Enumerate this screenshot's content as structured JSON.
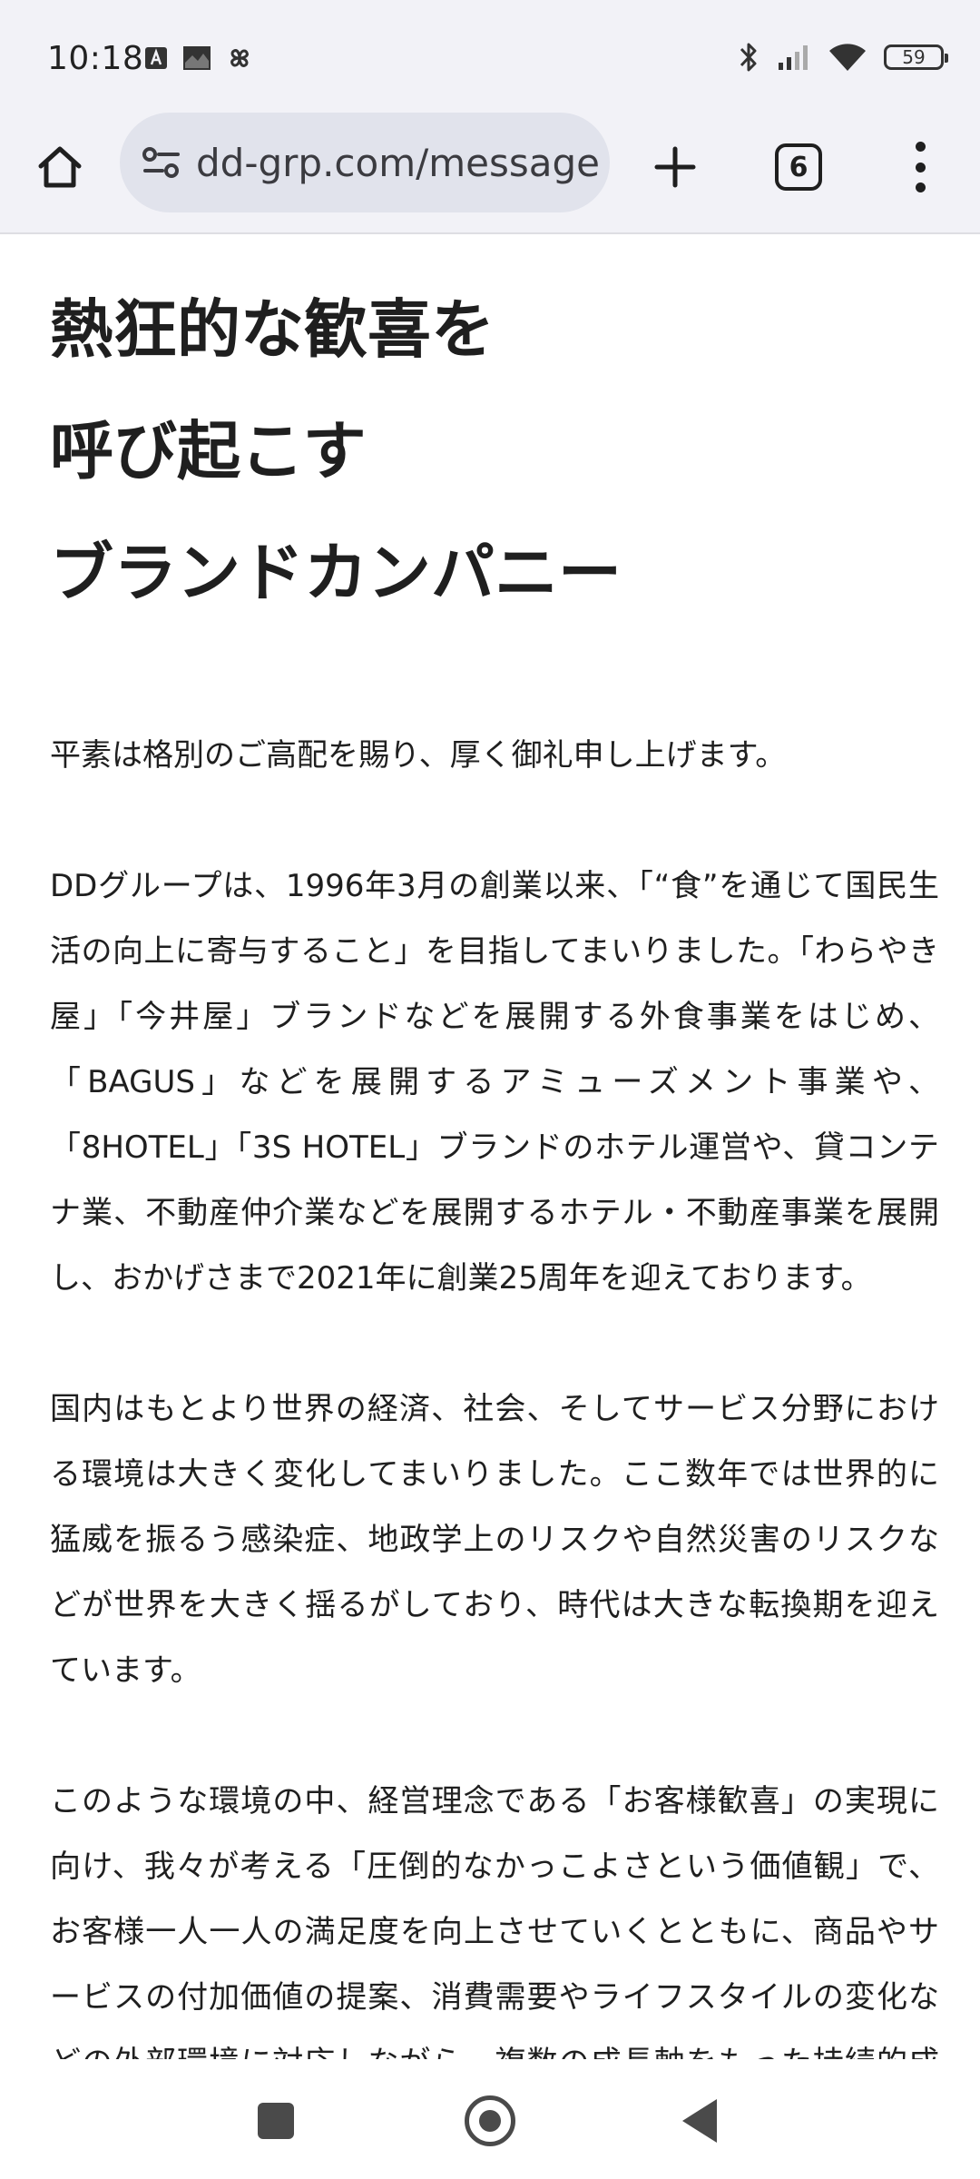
{
  "status_bar": {
    "time": "10:18",
    "battery": "59",
    "icons": [
      "a-notification-icon",
      "photo-notification-icon",
      "pinwheel-notification-icon",
      "bluetooth-icon",
      "cellular-signal-icon",
      "wifi-icon",
      "battery-icon"
    ]
  },
  "browser": {
    "url": "dd-grp.com/message",
    "tab_count": "6",
    "icons": [
      "home-icon",
      "site-settings-icon",
      "plus-icon",
      "tab-switcher-icon",
      "more-vert-icon"
    ]
  },
  "page": {
    "heading_lines": [
      "熱狂的な歓喜を",
      "呼び起こす",
      "ブランドカンパニー"
    ],
    "paragraphs": [
      "平素は格別のご高配を賜り、厚く御礼申し上げます。",
      "DDグループは、1996年3月の創業以来、「“食”を通じて国民生活の向上に寄与すること」を目指してまいりました。「わらやき屋」「今井屋」ブランドなどを展開する外食事業をはじめ、「BAGUS」などを展開するアミューズメント事業や、「8HOTEL」「3S HOTEL」ブランドのホテル運営や、貸コンテナ業、不動産仲介業などを展開するホテル・不動産事業を展開し、おかげさまで2021年に創業25周年を迎えております。",
      "国内はもとより世界の経済、社会、そしてサービス分野における環境は大きく変化してまいりました。ここ数年では世界的に猛威を振るう感染症、地政学上のリスクや自然災害のリスクなどが世界を大きく揺るがしており、時代は大きな転換期を迎えています。",
      "このような環境の中、経営理念である「お客様歓喜」の実現に向け、我々が考える「圧倒的なかっこよさという価値観」で、お客様一人一人の満足度を向上させていくとともに、商品やサービスの付加価値の提案、消費需要やライフスタイルの変化などの外部環境に対応しながら、複数の成長軸をもった持続的成長の実現と企業価値の向上を果たしてまいります。"
    ]
  },
  "nav_bar": {
    "icons": [
      "recents-icon",
      "home-circle-icon",
      "back-icon"
    ]
  }
}
